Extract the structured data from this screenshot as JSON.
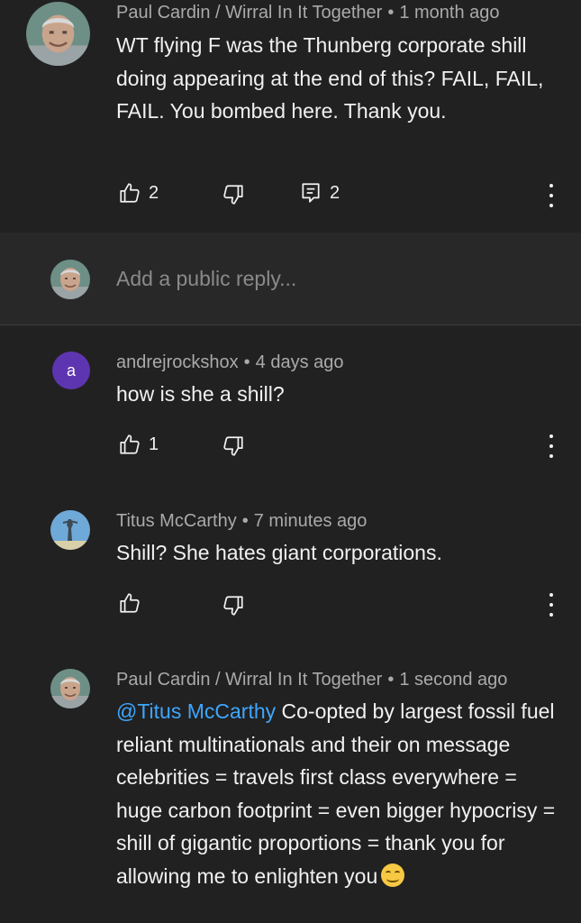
{
  "comments": [
    {
      "author": "Paul Cardin / Wirral In It Together",
      "time": "1 month ago",
      "text": "WT flying F was the Thunberg corporate shill doing appearing at the end of this? FAIL, FAIL, FAIL. You bombed here. Thank you.",
      "likes": "2",
      "replies": "2"
    },
    {
      "author": "andrejrockshox",
      "avatar_letter": "a",
      "time": "4 days ago",
      "text": "how is she a shill?",
      "likes": "1"
    },
    {
      "author": "Titus McCarthy",
      "time": "7 minutes ago",
      "text": "Shill? She hates giant corporations."
    },
    {
      "author": "Paul Cardin / Wirral In It Together",
      "time": "1 second ago",
      "mention": "@Titus McCarthy",
      "text": " Co-opted by largest fossil fuel reliant multinationals and their on message celebrities = travels first class everywhere = huge carbon footprint = even bigger hypocrisy = shill of gigantic proportions = thank you for allowing me to enlighten you"
    }
  ],
  "reply_box": {
    "placeholder": "Add a public reply..."
  },
  "icons": [
    "like-icon",
    "dislike-icon",
    "reply-icon",
    "more-options-icon",
    "smiling-face-emoji"
  ],
  "colors": {
    "background": "#212121",
    "reply_box": "#282828",
    "mention": "#3ea6ff",
    "meta": "#aaaaaa",
    "avatar_a": "#5e35b1"
  }
}
